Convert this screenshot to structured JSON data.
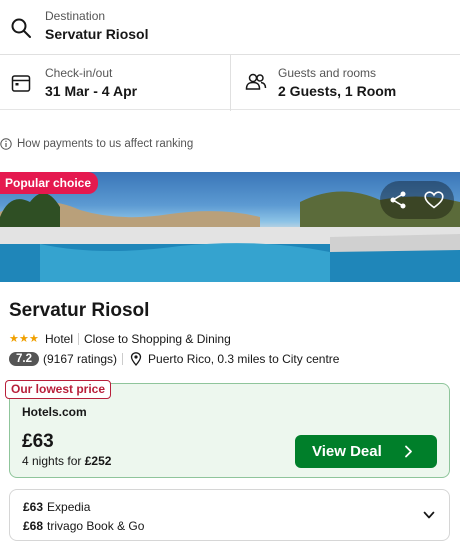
{
  "search": {
    "destination_label": "Destination",
    "destination_value": "Servatur Riosol",
    "dates_label": "Check-in/out",
    "dates_value": "31 Mar - 4 Apr",
    "guests_label": "Guests and rooms",
    "guests_value": "2 Guests, 1 Room"
  },
  "payments_note": "How payments to us affect ranking",
  "listing": {
    "badge": "Popular choice",
    "name": "Servatur Riosol",
    "stars": 3,
    "type": "Hotel",
    "tag": "Close to Shopping & Dining",
    "rating": "7.2",
    "rating_count": "(9167 ratings)",
    "location": "Puerto Rico, 0.3 miles to City centre"
  },
  "deal": {
    "badge": "Our lowest price",
    "provider": "Hotels.com",
    "price": "£63",
    "nights_text": "4 nights for",
    "total": "£252",
    "button": "View Deal"
  },
  "other_offers": [
    {
      "price": "£63",
      "provider": "Expedia"
    },
    {
      "price": "£68",
      "provider": "trivago Book & Go"
    }
  ],
  "colors": {
    "popular_badge": "#e5194f",
    "deal_button": "#007f2a",
    "deal_card_bg": "#edf7ee",
    "star": "#f0a000"
  }
}
